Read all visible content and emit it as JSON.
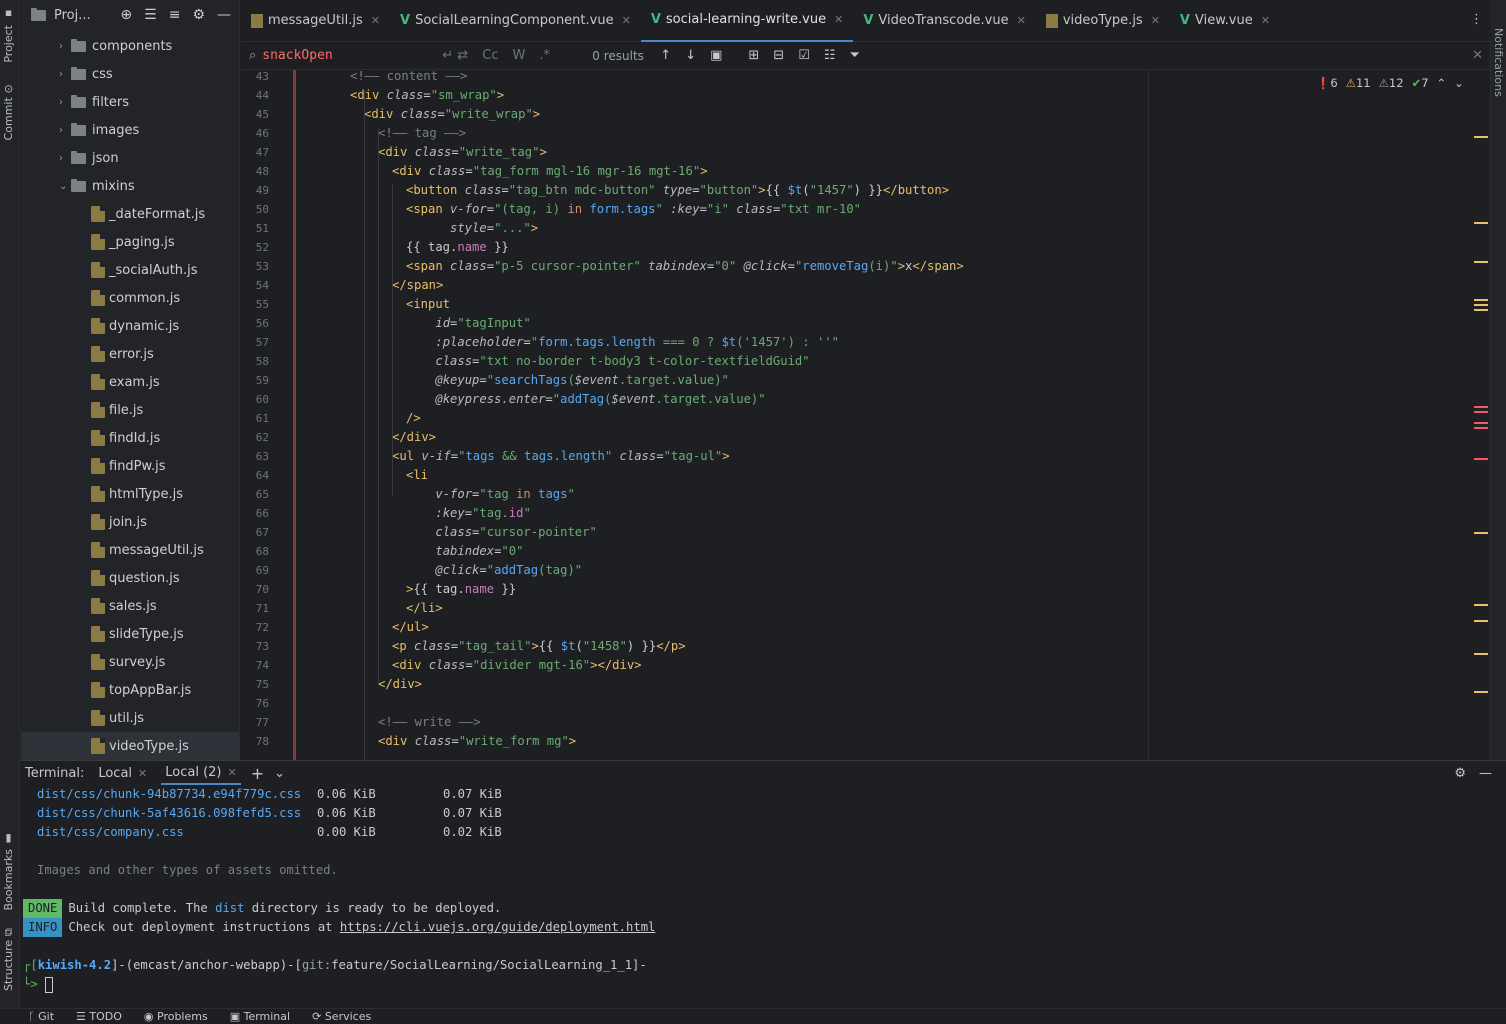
{
  "sidebar_left": {
    "project": "Project",
    "commit": "Commit",
    "bookmarks": "Bookmarks",
    "structure": "Structure"
  },
  "sidebar_right": {
    "notifications": "Notifications"
  },
  "project": {
    "title": "Proj...",
    "items": [
      {
        "label": "components",
        "type": "folder"
      },
      {
        "label": "css",
        "type": "folder"
      },
      {
        "label": "filters",
        "type": "folder"
      },
      {
        "label": "images",
        "type": "folder"
      },
      {
        "label": "json",
        "type": "folder"
      },
      {
        "label": "mixins",
        "type": "folder-open"
      },
      {
        "label": "_dateFormat.js",
        "type": "file"
      },
      {
        "label": "_paging.js",
        "type": "file"
      },
      {
        "label": "_socialAuth.js",
        "type": "file"
      },
      {
        "label": "common.js",
        "type": "file"
      },
      {
        "label": "dynamic.js",
        "type": "file"
      },
      {
        "label": "error.js",
        "type": "file"
      },
      {
        "label": "exam.js",
        "type": "file"
      },
      {
        "label": "file.js",
        "type": "file"
      },
      {
        "label": "findId.js",
        "type": "file"
      },
      {
        "label": "findPw.js",
        "type": "file"
      },
      {
        "label": "htmlType.js",
        "type": "file"
      },
      {
        "label": "join.js",
        "type": "file"
      },
      {
        "label": "messageUtil.js",
        "type": "file"
      },
      {
        "label": "question.js",
        "type": "file"
      },
      {
        "label": "sales.js",
        "type": "file"
      },
      {
        "label": "slideType.js",
        "type": "file"
      },
      {
        "label": "survey.js",
        "type": "file"
      },
      {
        "label": "topAppBar.js",
        "type": "file"
      },
      {
        "label": "util.js",
        "type": "file"
      },
      {
        "label": "videoType.js",
        "type": "file",
        "selected": true
      }
    ]
  },
  "tabs": [
    {
      "label": "messageUtil.js",
      "icon": "js-file-icon"
    },
    {
      "label": "SocialLearningComponent.vue",
      "icon": "vue-file-icon"
    },
    {
      "label": "social-learning-write.vue",
      "icon": "vue-file-icon",
      "active": true
    },
    {
      "label": "VideoTranscode.vue",
      "icon": "vue-file-icon"
    },
    {
      "label": "videoType.js",
      "icon": "js-file-icon"
    },
    {
      "label": "View.vue",
      "icon": "vue-file-icon"
    }
  ],
  "search": {
    "query": "snackOpen",
    "case": "Cc",
    "word": "W",
    "regex": ".*",
    "results": "0 results"
  },
  "inspections": {
    "errors": "6",
    "warnings": "11",
    "weak": "12",
    "ok": "7"
  },
  "code": [
    {
      "n": "43",
      "h": "<span class='cm'>&lt;!–– content ––&gt;</span>",
      "i": 0
    },
    {
      "n": "44",
      "h": "<span class='tg'>&lt;div</span> <span class='at'>class</span>=<span class='st'>\"sm_wrap\"</span><span class='tg'>&gt;</span>",
      "i": 0
    },
    {
      "n": "45",
      "h": "<span class='tg'>&lt;div</span> <span class='at'>class</span>=<span class='st'>\"write_wrap\"</span><span class='tg'>&gt;</span>",
      "i": 1
    },
    {
      "n": "46",
      "h": "<span class='cm'>&lt;!–– tag ––&gt;</span>",
      "i": 2
    },
    {
      "n": "47",
      "h": "<span class='tg'>&lt;div</span> <span class='at'>class</span>=<span class='st'>\"write_tag\"</span><span class='tg'>&gt;</span>",
      "i": 2
    },
    {
      "n": "48",
      "h": "<span class='tg'>&lt;div</span> <span class='at'>class</span>=<span class='st'>\"tag_form mgl-16 mgr-16 mgt-16\"</span><span class='tg'>&gt;</span>",
      "i": 3
    },
    {
      "n": "49",
      "h": "<span class='tg'>&lt;button</span> <span class='at'>class</span>=<span class='st'>\"tag_btn mdc-button\"</span> <span class='at'>type</span>=<span class='st'>\"button\"</span><span class='tg'>&gt;</span>{{ <span class='fn'>$t</span>(<span class='st'>\"1457\"</span>) }}<span class='tg'>&lt;/button&gt;</span>",
      "i": 4
    },
    {
      "n": "50",
      "h": "<span class='tg'>&lt;span</span> <span class='at'>v-for</span>=<span class='st'>\"(tag, i) <span class='kw'>in</span> <span class='fn'>form.tags</span>\"</span> <span class='at'>:key</span>=<span class='st'>\"i\"</span> <span class='at'>class</span>=<span class='st'>\"txt mr-10\"</span>",
      "i": 4
    },
    {
      "n": "51",
      "h": "      <span class='at'>style</span>=<span class='st'>\"...\"</span><span class='tg'>&gt;</span>",
      "i": 4
    },
    {
      "n": "52",
      "h": "{{ tag.<span class='id'>name</span> }}",
      "i": 4
    },
    {
      "n": "53",
      "h": "<span class='tg'>&lt;span</span> <span class='at'>class</span>=<span class='st'>\"p-5 cursor-pointer\"</span> <span class='at'>tabindex</span>=<span class='st'>\"0\"</span> <span class='at'>@click</span>=<span class='st'>\"<span class='fn'>removeTag</span>(i)\"</span><span class='tg'>&gt;</span>x<span class='tg'>&lt;/span&gt;</span>",
      "i": 4
    },
    {
      "n": "54",
      "h": "<span class='tg'>&lt;/span&gt;</span>",
      "i": 3
    },
    {
      "n": "55",
      "h": "<span class='tg'>&lt;input</span>",
      "i": 4
    },
    {
      "n": "56",
      "h": "    <span class='at'>id</span>=<span class='st'>\"tagInput\"</span>",
      "i": 4
    },
    {
      "n": "57",
      "h": "    <span class='at'>:placeholder</span>=<span class='st'>\"<span class='fn'>form.tags.length</span> === 0 ? <span class='fn'>$t</span>('1457') : ''\"</span>",
      "i": 4
    },
    {
      "n": "58",
      "h": "    <span class='at'>class</span>=<span class='st'>\"txt no-border t-body3 t-color-textfieldGuid\"</span>",
      "i": 4
    },
    {
      "n": "59",
      "h": "    <span class='at'>@keyup</span>=<span class='st'>\"<span class='fn'>searchTags</span>(<span class='at'>$event</span>.target.value)\"</span>",
      "i": 4
    },
    {
      "n": "60",
      "h": "    <span class='at'>@keypress.enter</span>=<span class='st'>\"<span class='fn'>addTag</span>(<span class='at'>$event</span>.target.value)\"</span>",
      "i": 4
    },
    {
      "n": "61",
      "h": "<span class='tg'>/&gt;</span>",
      "i": 4
    },
    {
      "n": "62",
      "h": "<span class='tg'>&lt;/div&gt;</span>",
      "i": 3
    },
    {
      "n": "63",
      "h": "<span class='tg'>&lt;ul</span> <span class='at'>v-if</span>=<span class='st'>\"<span class='fn'>tags</span> &amp;&amp; <span class='fn'>tags.length</span>\"</span> <span class='at'>class</span>=<span class='st'>\"tag-ul\"</span><span class='tg'>&gt;</span>",
      "i": 3
    },
    {
      "n": "64",
      "h": "<span class='tg'>&lt;li</span>",
      "i": 4
    },
    {
      "n": "65",
      "h": "    <span class='at'>v-for</span>=<span class='st'>\"tag <span class='kw'>in</span> <span class='fn'>tags</span>\"</span>",
      "i": 4
    },
    {
      "n": "66",
      "h": "    <span class='at'>:key</span>=<span class='st'>\"tag.<span class='id'>id</span>\"</span>",
      "i": 4
    },
    {
      "n": "67",
      "h": "    <span class='at'>class</span>=<span class='st'>\"cursor-pointer\"</span>",
      "i": 4
    },
    {
      "n": "68",
      "h": "    <span class='at'>tabindex</span>=<span class='st'>\"0\"</span>",
      "i": 4
    },
    {
      "n": "69",
      "h": "    <span class='at'>@click</span>=<span class='st'>\"<span class='fn'>addTag</span>(tag)\"</span>",
      "i": 4
    },
    {
      "n": "70",
      "h": "<span class='tg'>&gt;</span>{{ tag.<span class='id'>name</span> }}",
      "i": 4
    },
    {
      "n": "71",
      "h": "<span class='tg'>&lt;/li&gt;</span>",
      "i": 4
    },
    {
      "n": "72",
      "h": "<span class='tg'>&lt;/ul&gt;</span>",
      "i": 3
    },
    {
      "n": "73",
      "h": "<span class='tg'>&lt;p</span> <span class='at'>class</span>=<span class='st'>\"tag_tail\"</span><span class='tg'>&gt;</span>{{ <span class='fn'>$t</span>(<span class='st'>\"1458\"</span>) }}<span class='tg'>&lt;/p&gt;</span>",
      "i": 3
    },
    {
      "n": "74",
      "h": "<span class='tg'>&lt;div</span> <span class='at'>class</span>=<span class='st'>\"divider mgt-16\"</span><span class='tg'>&gt;&lt;/div&gt;</span>",
      "i": 3
    },
    {
      "n": "75",
      "h": "<span class='tg'>&lt;/div&gt;</span>",
      "i": 2
    },
    {
      "n": "76",
      "h": "",
      "i": 0
    },
    {
      "n": "77",
      "h": "<span class='cm'>&lt;!–– write ––&gt;</span>",
      "i": 2
    },
    {
      "n": "78",
      "h": "<span class='tg'>&lt;div</span> <span class='at'>class</span>=<span class='st'>\"write_form mg\"</span><span class='tg'>&gt;</span>",
      "i": 2
    }
  ],
  "terminal": {
    "title": "Terminal:",
    "tab1": "Local",
    "tab2": "Local (2)",
    "lines": [
      {
        "file": "dist/css/chunk-94b87734.e94f779c.css",
        "size": "0.06 KiB",
        "gz": "0.07 KiB"
      },
      {
        "file": "dist/css/chunk-5af43616.098fefd5.css",
        "size": "0.06 KiB",
        "gz": "0.07 KiB"
      },
      {
        "file": "dist/css/company.css",
        "size": "0.00 KiB",
        "gz": "0.02 KiB"
      }
    ],
    "omitted": "Images and other types of assets omitted.",
    "done_badge": "DONE",
    "done_a": "Build complete. The ",
    "done_dist": "dist",
    "done_b": " directory is ready to be deployed.",
    "info_badge": "INFO",
    "info_text": "Check out deployment instructions at ",
    "info_link": "https://cli.vuejs.org/guide/deployment.html",
    "prompt_open": "┌[",
    "prompt_host": "kiwish-4.2",
    "prompt_mid": "]-(emcast/anchor-webapp)-[",
    "prompt_git": "git:",
    "prompt_branch": "feature/SocialLearning/SocialLearning_1_1",
    "prompt_close": "]-",
    "prompt_arrow": "└>"
  },
  "statusbar": {
    "git": "Git",
    "todo": "TODO",
    "problems": "Problems",
    "terminal": "Terminal",
    "services": "Services"
  },
  "colors": {
    "accent": "#4a88c7",
    "error": "#f75464",
    "warning": "#e8bf6a",
    "ok": "#5fb865",
    "done": "#5fb865",
    "info": "#3592c4"
  }
}
